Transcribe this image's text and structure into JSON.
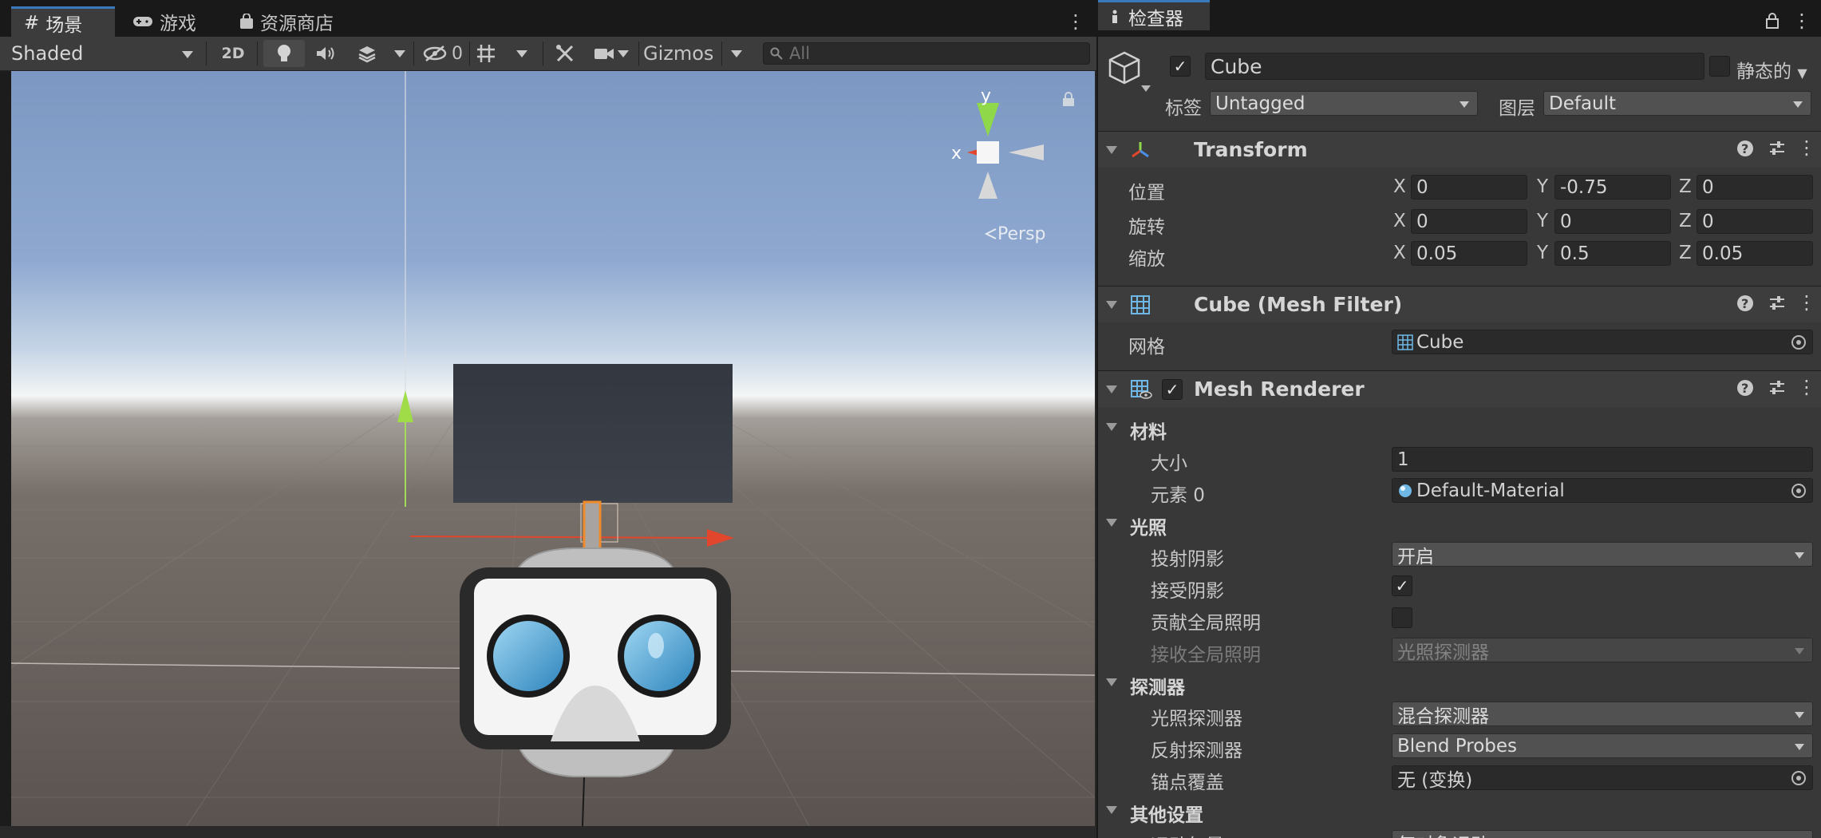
{
  "scene_tabs": {
    "scene": "场景",
    "game": "游戏",
    "asset_store": "资源商店"
  },
  "scene_toolbar": {
    "shading_mode": "Shaded",
    "mode_2d": "2D",
    "hidden_count": "0",
    "gizmos": "Gizmos",
    "search_placeholder": "All"
  },
  "scene_gizmo": {
    "axis_x": "x",
    "axis_y": "y",
    "projection": "Persp"
  },
  "inspector": {
    "tab_title": "检查器",
    "object": {
      "name": "Cube",
      "active": true,
      "static_label": "静态的",
      "tag_label": "标签",
      "tag_value": "Untagged",
      "layer_label": "图层",
      "layer_value": "Default"
    },
    "transform": {
      "title": "Transform",
      "position_label": "位置",
      "rotation_label": "旋转",
      "scale_label": "缩放",
      "axis_x": "X",
      "axis_y": "Y",
      "axis_z": "Z",
      "position": {
        "x": "0",
        "y": "-0.75",
        "z": "0"
      },
      "rotation": {
        "x": "0",
        "y": "0",
        "z": "0"
      },
      "scale": {
        "x": "0.05",
        "y": "0.5",
        "z": "0.05"
      }
    },
    "mesh_filter": {
      "title": "Cube (Mesh Filter)",
      "mesh_label": "网格",
      "mesh_value": "Cube"
    },
    "mesh_renderer": {
      "title": "Mesh Renderer",
      "enabled": true,
      "materials_section": "材料",
      "size_label": "大小",
      "size_value": "1",
      "element0_label": "元素 0",
      "element0_value": "Default-Material",
      "lighting_section": "光照",
      "cast_shadows_label": "投射阴影",
      "cast_shadows_value": "开启",
      "receive_shadows_label": "接受阴影",
      "receive_shadows": true,
      "contribute_gi_label": "贡献全局照明",
      "contribute_gi": false,
      "receive_gi_label": "接收全局照明",
      "receive_gi_value": "光照探测器",
      "probes_section": "探测器",
      "light_probes_label": "光照探测器",
      "light_probes_value": "混合探测器",
      "reflection_probes_label": "反射探测器",
      "reflection_probes_value": "Blend Probes",
      "anchor_override_label": "锚点覆盖",
      "anchor_override_value": "无 (变换)",
      "other_section": "其他设置",
      "motion_vectors_label": "运动矢量",
      "motion_vectors_value": "每对象运动"
    }
  },
  "colors": {
    "accent": "#3a79bb",
    "x_axis": "#e2462c",
    "y_axis": "#8fd84a",
    "panel": "#383838",
    "field": "#2a2a2a"
  }
}
